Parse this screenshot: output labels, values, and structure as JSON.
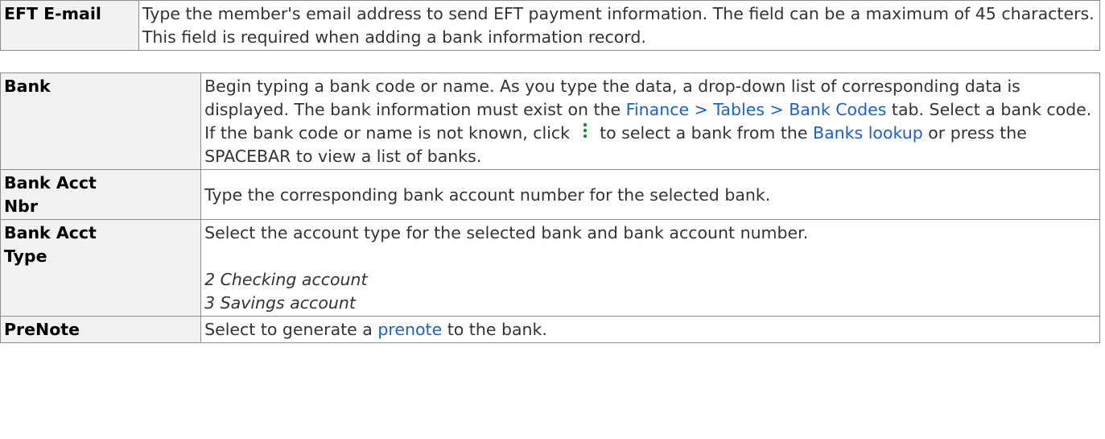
{
  "rows": [
    {
      "label": "EFT E-mail",
      "desc": "Type the member's email address to send EFT payment information. The field can be a maximum of 45 characters. This field is required when adding a bank information record."
    },
    {
      "label": "Bank",
      "desc_1": "Begin typing a bank code or name. As you type the data, a drop-down list of corresponding data is displayed. The bank information must exist on the ",
      "link_finance": "Finance > Tables > Bank Codes",
      "desc_2": " tab. Select a bank code. If the bank code or name is not known, click ",
      "icon": "kebab-icon",
      "desc_3": " to select a bank from the ",
      "link_banks": "Banks lookup",
      "desc_4": " or press the SPACEBAR to view a list of banks."
    },
    {
      "label_1": "Bank Acct",
      "label_2": "Nbr",
      "desc": "Type the corresponding bank account number for the selected bank."
    },
    {
      "label_1": "Bank Acct",
      "label_2": "Type",
      "desc": "Select the account type for the selected bank and bank account number.",
      "options": [
        "2 Checking account",
        "3 Savings account"
      ]
    },
    {
      "label": "PreNote",
      "desc_1": "Select to generate a ",
      "link_prenote": "prenote",
      "desc_2": " to the bank."
    }
  ],
  "colors": {
    "link": "#1a5fd6",
    "border": "#8c8c8c",
    "label_bg": "#f2f2f2",
    "icon": "#1f8a2a"
  }
}
